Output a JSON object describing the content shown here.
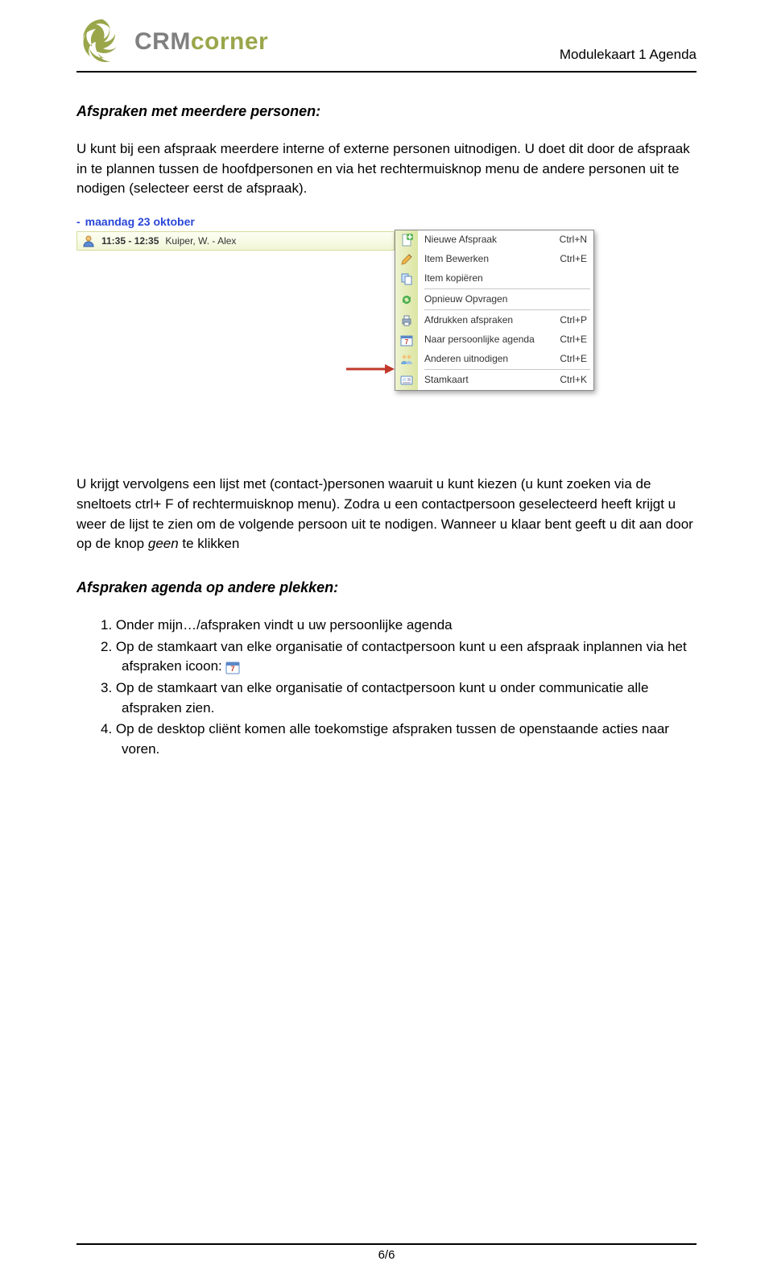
{
  "doc": {
    "brand_a": "CRM",
    "brand_b": "corner",
    "header_title": "Modulekaart 1 Agenda",
    "page_footer": "6/6"
  },
  "sections": {
    "s1_title": "Afspraken met meerdere personen:",
    "s1_p1": "U kunt bij een afspraak meerdere interne of externe personen uitnodigen. U doet dit door de afspraak in te plannen tussen de hoofdpersonen en via het rechtermuisknop menu de andere personen uit te nodigen (selecteer eerst de afspraak).",
    "s1_p2a": "U krijgt vervolgens een lijst met (contact-)personen waaruit u kunt kiezen (u kunt zoeken via de sneltoets ctrl+ F of rechtermuisknop menu). Zodra u een contactpersoon geselecteerd heeft krijgt u weer de lijst te zien om de volgende persoon uit te nodigen. Wanneer u klaar bent geeft u dit aan door op de knop ",
    "s1_p2_em": "geen",
    "s1_p2b": " te klikken",
    "s2_title": "Afspraken agenda op andere plekken:",
    "list": {
      "i1": "Onder mijn…/afspraken vindt u uw persoonlijke agenda",
      "i2a": "Op de stamkaart van elke organisatie of contactpersoon kunt u een afspraak inplannen via het afspraken icoon: ",
      "i3": "Op de stamkaart van elke organisatie of contactpersoon kunt u onder communicatie alle afspraken zien.",
      "i4": "Op de desktop cliënt komen alle toekomstige afspraken tussen de openstaande acties naar voren."
    }
  },
  "screenshot": {
    "date_label": "maandag 23 oktober",
    "appt_time": "11:35 - 12:35",
    "appt_label": "Kuiper, W. - Alex",
    "menu": [
      {
        "label": "Nieuwe Afspraak",
        "shortcut": "Ctrl+N",
        "icon": "plus-page"
      },
      {
        "label": "Item Bewerken",
        "shortcut": "Ctrl+E",
        "icon": "pencil"
      },
      {
        "label": "Item kopiëren",
        "shortcut": "",
        "icon": "copy"
      },
      {
        "sep": true
      },
      {
        "label": "Opnieuw Opvragen",
        "shortcut": "",
        "icon": "refresh"
      },
      {
        "sep": true
      },
      {
        "label": "Afdrukken afspraken",
        "shortcut": "Ctrl+P",
        "icon": "printer"
      },
      {
        "label": "Naar persoonlijke agenda",
        "shortcut": "Ctrl+E",
        "icon": "calendar"
      },
      {
        "label": "Anderen uitnodigen",
        "shortcut": "Ctrl+E",
        "icon": "people"
      },
      {
        "sep": true
      },
      {
        "label": "Stamkaart",
        "shortcut": "Ctrl+K",
        "icon": "card"
      }
    ]
  }
}
